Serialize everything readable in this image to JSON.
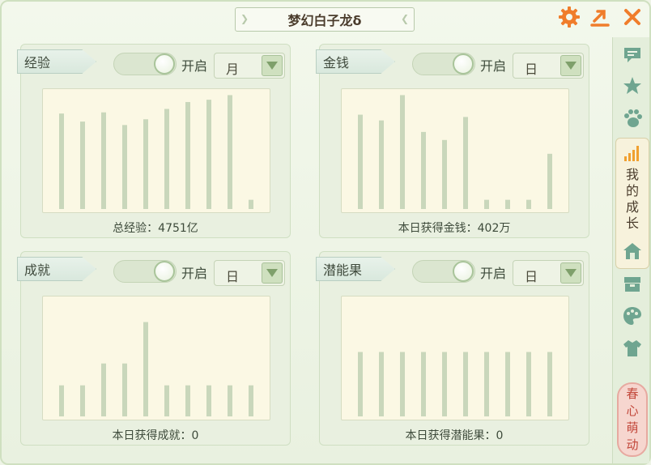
{
  "window": {
    "title": "梦幻白子龙δ"
  },
  "icons": {
    "settings": "gear-icon",
    "export": "export-arrow-icon",
    "close": "close-icon"
  },
  "colors": {
    "bar": "#c9d7bb",
    "accent": "#f07d2b",
    "toggle_knob": "#a9c49a"
  },
  "panels": [
    {
      "label": "经验",
      "toggle_label": "开启",
      "toggle_on": true,
      "period": "月",
      "footer": "总经验：4751亿",
      "chart_data": {
        "type": "bar",
        "values": [
          0.83,
          0.76,
          0.84,
          0.73,
          0.78,
          0.87,
          0.93,
          0.95,
          0.99,
          0.08
        ]
      }
    },
    {
      "label": "金钱",
      "toggle_label": "开启",
      "toggle_on": true,
      "period": "日",
      "footer": "本日获得金钱：402万",
      "chart_data": {
        "type": "bar",
        "values": [
          0.82,
          0.77,
          0.99,
          0.67,
          0.6,
          0.8,
          0.08,
          0.08,
          0.08,
          0.48
        ]
      }
    },
    {
      "label": "成就",
      "toggle_label": "开启",
      "toggle_on": true,
      "period": "日",
      "footer": "本日获得成就：0",
      "chart_data": {
        "type": "bar",
        "values": [
          0.27,
          0.27,
          0.46,
          0.46,
          0.82,
          0.27,
          0.27,
          0.27,
          0.27,
          0.27
        ]
      }
    },
    {
      "label": "潜能果",
      "toggle_label": "开启",
      "toggle_on": true,
      "period": "日",
      "footer": "本日获得潜能果：0",
      "chart_data": {
        "type": "bar",
        "values": [
          0.56,
          0.56,
          0.56,
          0.56,
          0.56,
          0.56,
          0.56,
          0.56,
          0.56,
          0.56
        ]
      }
    }
  ],
  "sidebar": {
    "items": [
      {
        "icon": "chat-bubble-icon"
      },
      {
        "icon": "star-icon"
      },
      {
        "icon": "paw-icon"
      },
      {
        "icon": "signal-bars-icon",
        "label": "我的成长",
        "active": true
      },
      {
        "icon": "house-icon"
      },
      {
        "icon": "chest-icon"
      },
      {
        "icon": "palette-icon"
      },
      {
        "icon": "shirt-icon"
      }
    ],
    "badge": "春心萌动"
  }
}
